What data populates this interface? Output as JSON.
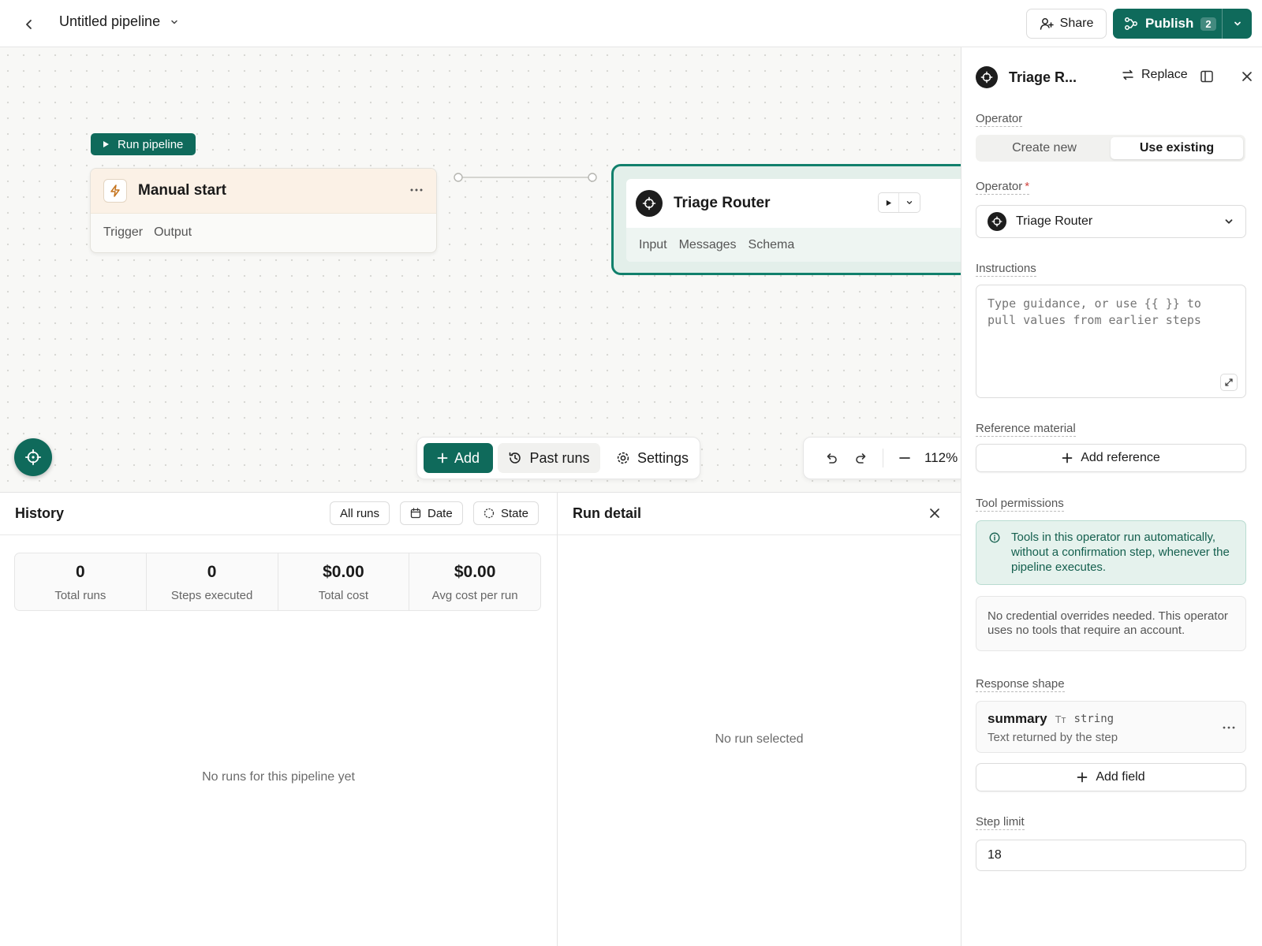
{
  "header": {
    "title": "Untitled pipeline",
    "share_label": "Share",
    "publish_label": "Publish",
    "publish_count": "2"
  },
  "canvas": {
    "run_pipeline_label": "Run pipeline",
    "manual_node": {
      "title": "Manual start",
      "tabs": [
        "Trigger",
        "Output"
      ]
    },
    "triage_node": {
      "title": "Triage Router",
      "tabs": [
        "Input",
        "Messages",
        "Schema"
      ]
    },
    "toolbar": {
      "add_label": "Add",
      "past_runs_label": "Past runs",
      "settings_label": "Settings"
    },
    "zoom": "112%"
  },
  "history": {
    "title": "History",
    "filters": {
      "all_runs": "All runs",
      "date": "Date",
      "state": "State"
    },
    "stats": [
      {
        "value": "0",
        "label": "Total runs"
      },
      {
        "value": "0",
        "label": "Steps executed"
      },
      {
        "value": "$0.00",
        "label": "Total cost"
      },
      {
        "value": "$0.00",
        "label": "Avg cost per run"
      }
    ],
    "empty_text": "No runs for this pipeline yet"
  },
  "run_detail": {
    "title": "Run detail",
    "empty_text": "No run selected"
  },
  "sidebar": {
    "title": "Triage R...",
    "replace_label": "Replace",
    "operator_label": "Operator",
    "segment": {
      "create_new": "Create new",
      "use_existing": "Use existing",
      "selected": "Use existing"
    },
    "operator_select_label": "Operator",
    "required_mark": "*",
    "operator_value": "Triage Router",
    "instructions_label": "Instructions",
    "instructions_placeholder": "Type guidance, or use {{ }} to pull values from earlier steps",
    "instructions_value": "",
    "reference_label": "Reference material",
    "add_reference_label": "Add reference",
    "tool_permissions_label": "Tool permissions",
    "tool_permissions_info": "Tools in this operator run automatically, without a confirmation step, whenever the pipeline executes.",
    "credential_note": "No credential overrides needed. This operator uses no tools that require an account.",
    "response_shape_label": "Response shape",
    "response_field": {
      "name": "summary",
      "type_icon_text": "Tт",
      "type": "string",
      "description": "Text returned by the step"
    },
    "add_field_label": "Add field",
    "step_limit_label": "Step limit",
    "step_limit_value": "18"
  },
  "colors": {
    "accent": "#0f6a5b",
    "info_bg": "#e5f2ed",
    "manual_header_bg": "#fbf1e6"
  }
}
